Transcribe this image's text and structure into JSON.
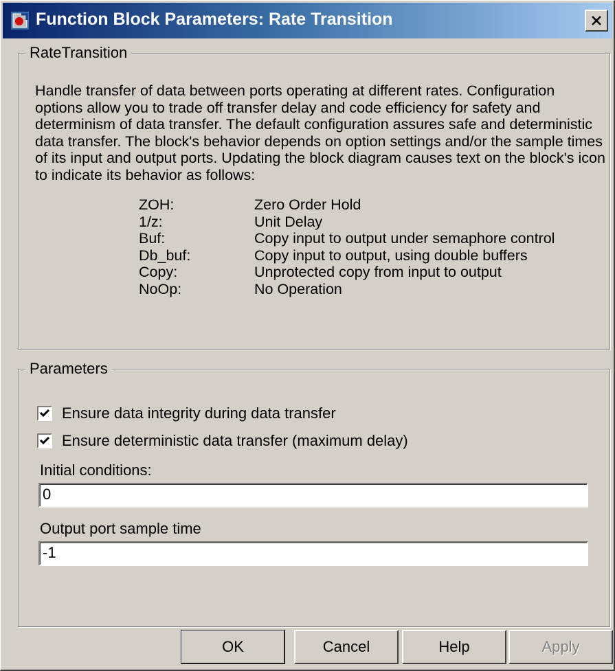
{
  "window": {
    "title": "Function Block Parameters: Rate Transition",
    "title_icon": "simulink-block-icon",
    "close_icon": "close-icon"
  },
  "block_group": {
    "label": "RateTransition",
    "description": "Handle transfer of data between ports operating at different rates. Configuration options allow you to trade off transfer delay and code efficiency for safety and determinism of data transfer. The default configuration assures safe and deterministic data transfer. The block's behavior depends on option settings and/or the sample times of its input and output ports. Updating the block diagram causes text on the block's icon to indicate its behavior as follows:",
    "codes": [
      {
        "code": "ZOH:",
        "meaning": "Zero Order Hold"
      },
      {
        "code": "1/z:",
        "meaning": "Unit Delay"
      },
      {
        "code": "Buf:",
        "meaning": "Copy input to output under semaphore control"
      },
      {
        "code": "Db_buf:",
        "meaning": "Copy input to output, using double buffers"
      },
      {
        "code": "Copy:",
        "meaning": "Unprotected copy from input to output"
      },
      {
        "code": "NoOp:",
        "meaning": "No Operation"
      }
    ]
  },
  "parameters": {
    "label": "Parameters",
    "ensure_integrity": {
      "label": "Ensure data integrity during data transfer",
      "checked": true
    },
    "ensure_deterministic": {
      "label": "Ensure deterministic data transfer (maximum delay)",
      "checked": true
    },
    "initial_conditions": {
      "label": "Initial conditions:",
      "value": "0"
    },
    "output_sample_time": {
      "label": "Output port sample time",
      "value": "-1"
    }
  },
  "buttons": {
    "ok": "OK",
    "cancel": "Cancel",
    "help": "Help",
    "apply": "Apply",
    "apply_enabled": false
  },
  "colors": {
    "title_gradient_start": "#0a246a",
    "title_gradient_end": "#a6caf0",
    "face": "#d4d0c8"
  }
}
